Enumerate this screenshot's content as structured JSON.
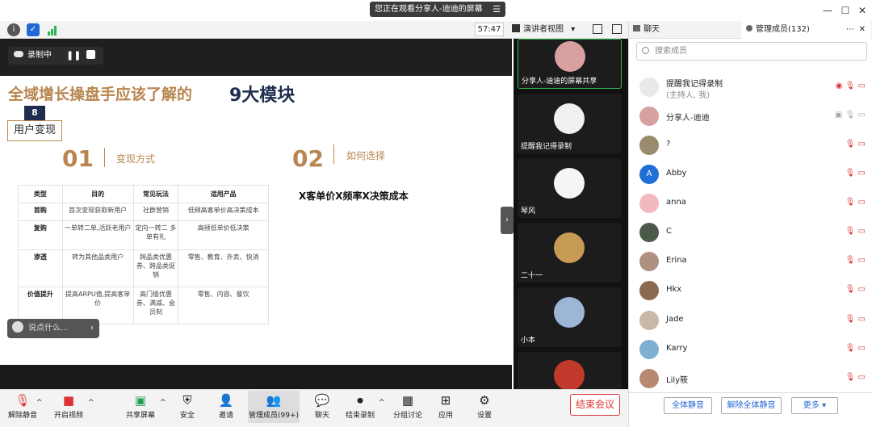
{
  "share_banner": {
    "text": "您正在观看分享人-迪迪的屏幕",
    "menu_icon": "menu-icon"
  },
  "window": {
    "minimize": "—",
    "maximize": "☐",
    "close": "✕"
  },
  "toolbar": {
    "timer": "57:47",
    "view_label": "演讲者视图"
  },
  "recording": {
    "label": "录制中"
  },
  "slide": {
    "title": "全域增长操盘手应该了解的",
    "title_highlight": "9大模块",
    "badge_number": "8",
    "badge_label": "用户变现",
    "sections": [
      {
        "num": "01",
        "label": "变现方式"
      },
      {
        "num": "02",
        "label": "如何选择"
      }
    ],
    "formula": "X客单价X频率X决策成本",
    "table": {
      "headers": [
        "类型",
        "目的",
        "常见玩法",
        "适用产品"
      ],
      "rows": [
        [
          "首购",
          "首次变现获取新用户",
          "社群营销",
          "低频高客单价高决策成本"
        ],
        [
          "复购",
          "一单转二单,活跃老用户",
          "定向一转二 多单有礼",
          "高频低单价低决策"
        ],
        [
          "渗透",
          "转为其他品类用户",
          "跨品类优惠券、跨品类促销",
          "零售、教育、外卖、快消"
        ],
        [
          "价值提升",
          "提高ARPU值,提高客单价",
          "高门槛优惠券、满减、会员制",
          "零售、内容、餐饮"
        ]
      ]
    }
  },
  "say_box": {
    "placeholder": "说点什么..."
  },
  "video_tiles": [
    {
      "name": "分享人-迪迪的屏幕共享"
    },
    {
      "name": "提醒我记得录制"
    },
    {
      "name": "琴风"
    },
    {
      "name": "二十一"
    },
    {
      "name": "小本"
    },
    {
      "name": ""
    }
  ],
  "panel": {
    "tab_chat": "聊天",
    "tab_members": "管理成员(132)",
    "search_placeholder": "搜索成员",
    "members": [
      {
        "name": "提醒我记得录制",
        "sub": "(主持人, 我)",
        "color": "#e9e9e9"
      },
      {
        "name": "分享人-迪迪",
        "sub": "",
        "color": "#d9a0a0"
      },
      {
        "name": "?",
        "sub": "",
        "color": "#9a8a6e"
      },
      {
        "name": "Abby",
        "sub": "",
        "color": "#1f6fd6",
        "initial": "A"
      },
      {
        "name": "anna",
        "sub": "",
        "color": "#f2b8c0"
      },
      {
        "name": "C",
        "sub": "",
        "color": "#4c5a4a"
      },
      {
        "name": "Erina",
        "sub": "",
        "color": "#b09080"
      },
      {
        "name": "Hkx",
        "sub": "",
        "color": "#8a6a50"
      },
      {
        "name": "Jade",
        "sub": "",
        "color": "#c9b8a8"
      },
      {
        "name": "Karry",
        "sub": "",
        "color": "#7fb0d0"
      },
      {
        "name": "Lily筱",
        "sub": "",
        "color": "#b58a70"
      }
    ],
    "mute_all": "全体静音",
    "unmute_all": "解除全体静音",
    "more": "更多"
  },
  "bottom": {
    "unmute": "解除静音",
    "video": "开启视频",
    "share": "共享屏幕",
    "security": "安全",
    "invite": "邀请",
    "members": "管理成员(99+)",
    "chat": "聊天",
    "end_record": "结束录制",
    "breakout": "分组讨论",
    "apps": "应用",
    "settings": "设置",
    "end_meeting": "结束会议"
  }
}
